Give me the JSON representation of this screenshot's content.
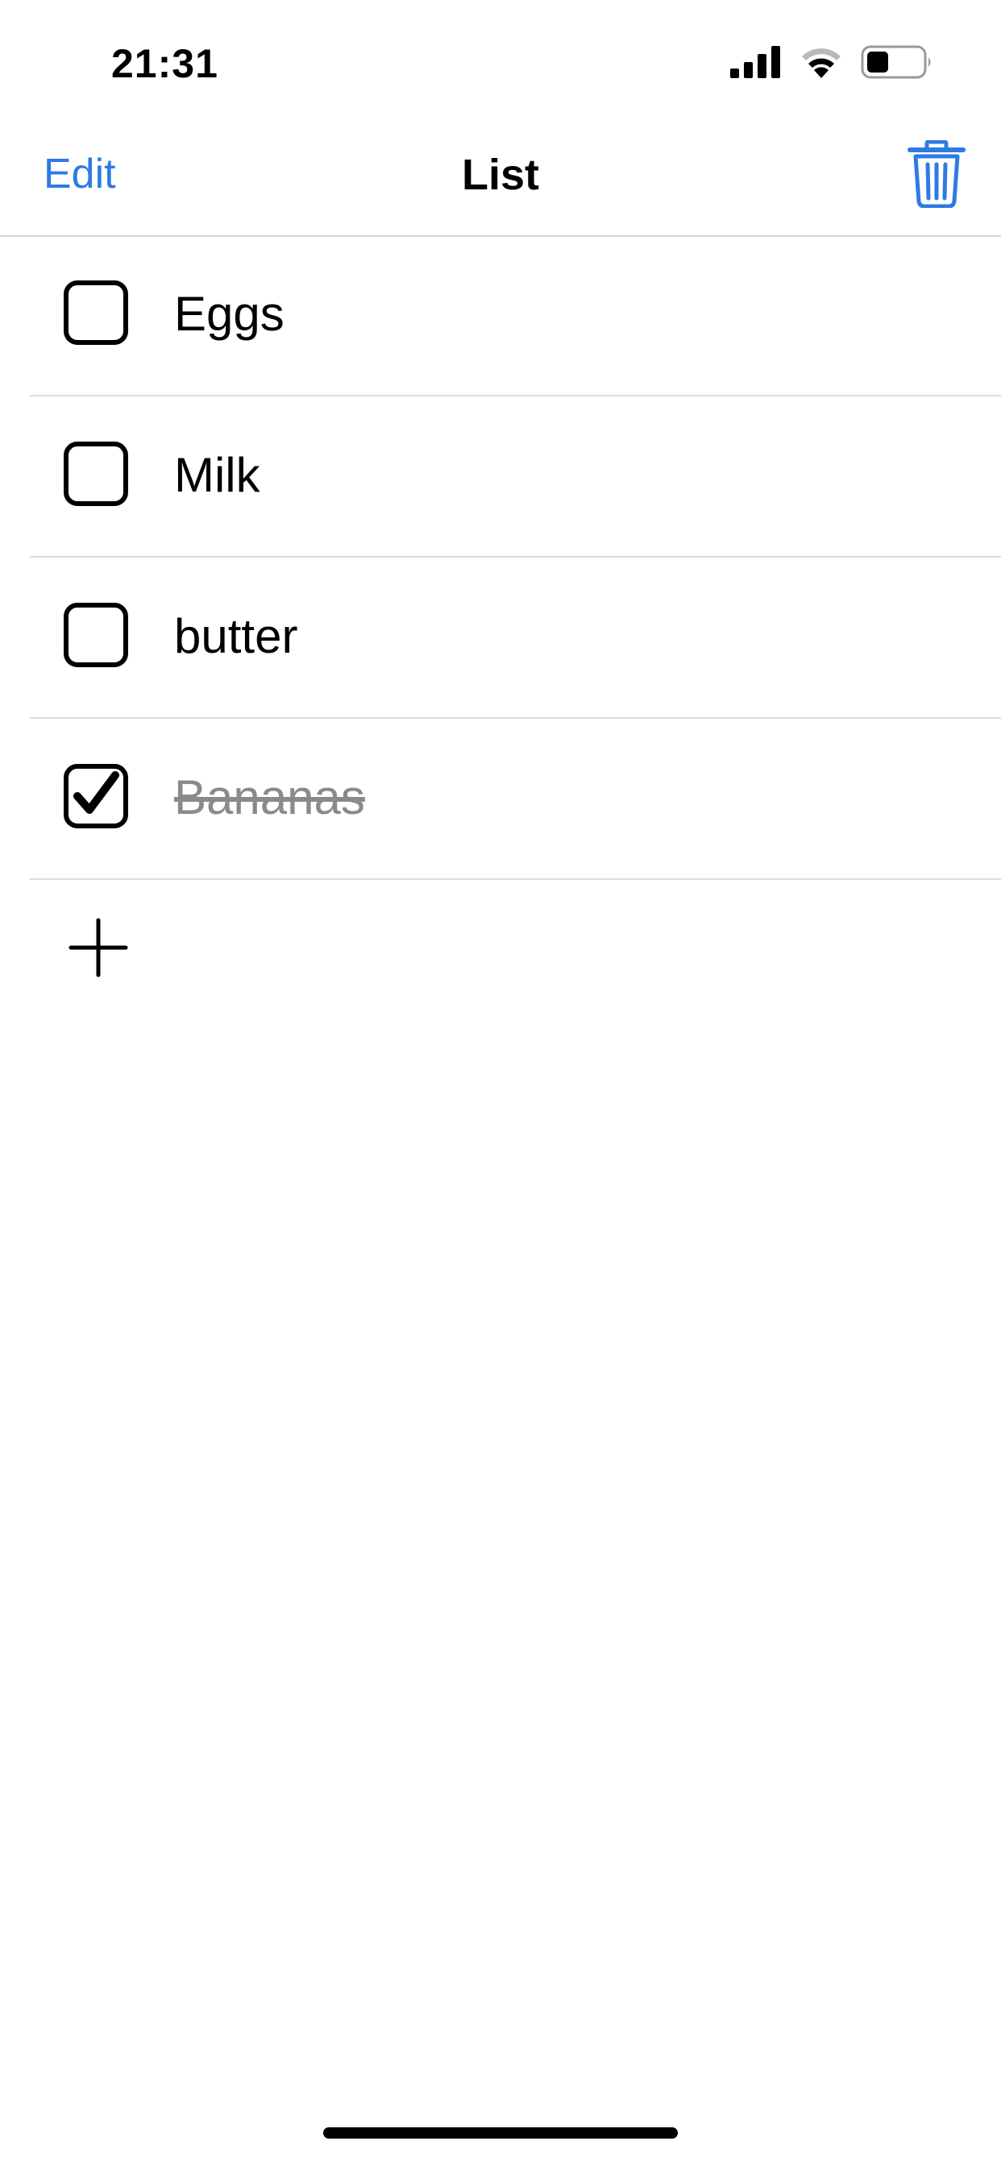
{
  "status_bar": {
    "time": "21:31",
    "icons": [
      "cellular-signal-icon",
      "wifi-icon",
      "battery-icon"
    ]
  },
  "nav": {
    "edit_label": "Edit",
    "title": "List",
    "trash_icon": "trash-icon"
  },
  "items": [
    {
      "label": "Eggs",
      "checked": false
    },
    {
      "label": "Milk",
      "checked": false
    },
    {
      "label": "butter",
      "checked": false
    },
    {
      "label": "Bananas",
      "checked": true
    }
  ],
  "add_icon": "plus-icon",
  "colors": {
    "accent": "#2f7ae3",
    "completed_text": "#8a8a8e",
    "separator": "#dcdcde"
  }
}
